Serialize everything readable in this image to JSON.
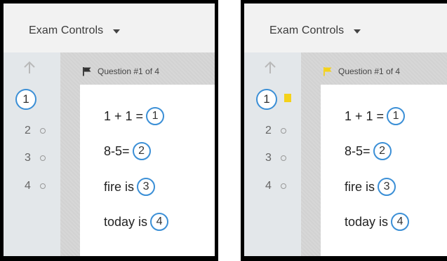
{
  "panels": [
    {
      "id": "left",
      "header": {
        "menu_label": "Exam Controls"
      },
      "question_title": "Question #1 of 4",
      "flagged": false,
      "nav": [
        {
          "label": "1",
          "current": true
        },
        {
          "label": "2",
          "current": false
        },
        {
          "label": "3",
          "current": false
        },
        {
          "label": "4",
          "current": false
        }
      ],
      "questions": [
        {
          "text": "1 + 1 =",
          "blank": "1"
        },
        {
          "text": "8-5=",
          "blank": "2"
        },
        {
          "text": "fire is",
          "blank": "3"
        },
        {
          "text": "today is",
          "blank": "4"
        }
      ]
    },
    {
      "id": "right",
      "header": {
        "menu_label": "Exam Controls"
      },
      "question_title": "Question #1 of 4",
      "flagged": true,
      "nav": [
        {
          "label": "1",
          "current": true
        },
        {
          "label": "2",
          "current": false
        },
        {
          "label": "3",
          "current": false
        },
        {
          "label": "4",
          "current": false
        }
      ],
      "questions": [
        {
          "text": "1 + 1 =",
          "blank": "1"
        },
        {
          "text": "8-5=",
          "blank": "2"
        },
        {
          "text": "fire is",
          "blank": "3"
        },
        {
          "text": "today is",
          "blank": "4"
        }
      ]
    }
  ],
  "colors": {
    "accent_blue": "#3b8fd6",
    "flag_yellow": "#f4d21a",
    "flag_dark": "#333333"
  },
  "icons": {
    "up": "up-arrow-icon",
    "menu_caret": "chevron-down-icon",
    "flag": "flag-icon"
  }
}
